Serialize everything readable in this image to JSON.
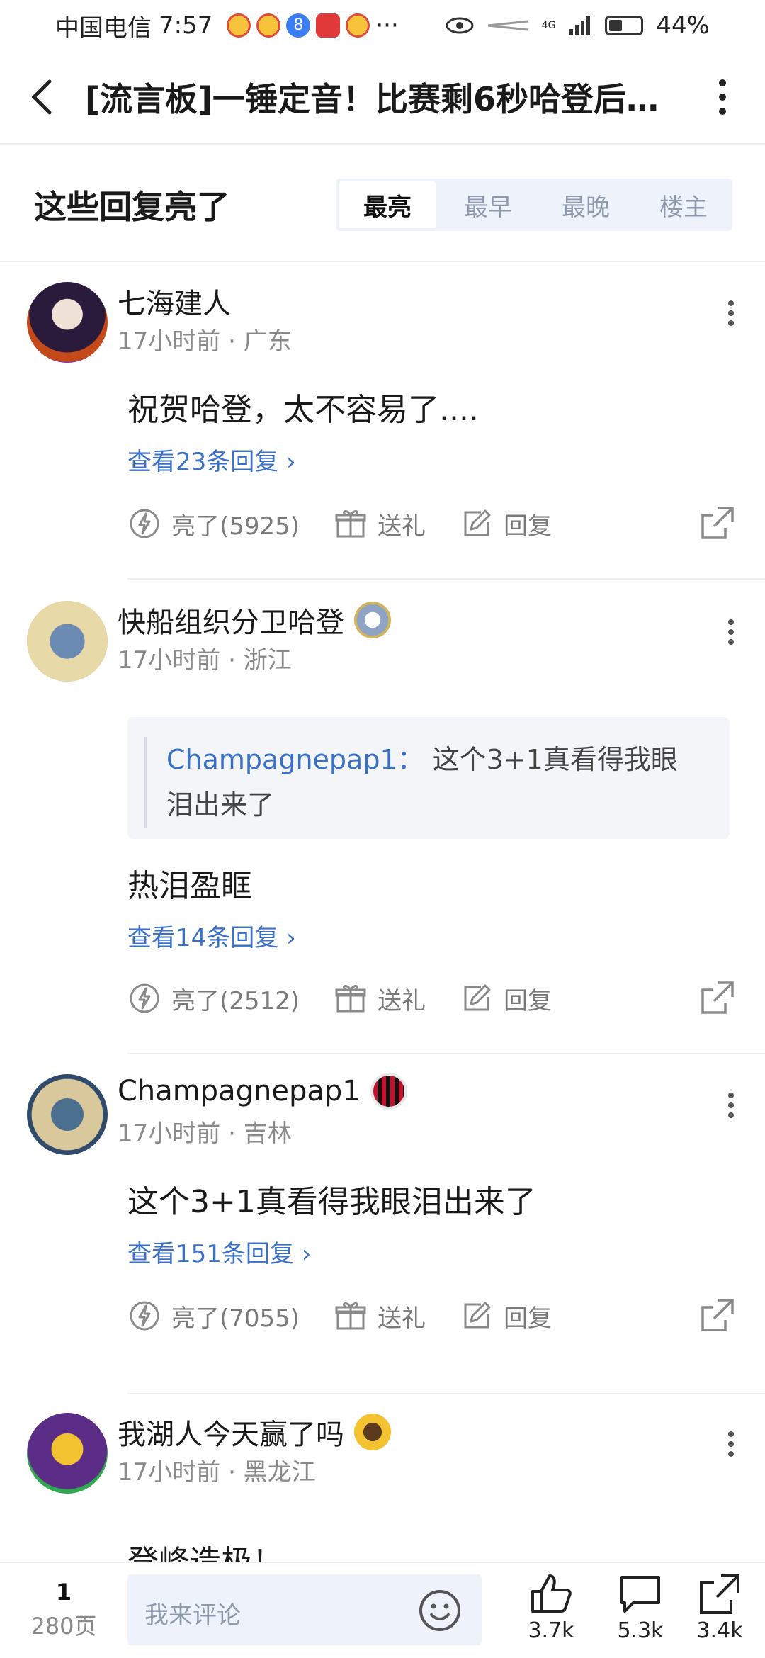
{
  "status_bar": {
    "carrier": "中国电信",
    "time": "7:57",
    "notif_dots": "···",
    "signal_label": "4G",
    "battery": "44%",
    "battery_level": 0.44
  },
  "header": {
    "title": "[流言板]一锤定音！比赛剩6秒哈登后…"
  },
  "section": {
    "title": "这些回复亮了",
    "tabs": [
      "最亮",
      "最早",
      "最晚",
      "楼主"
    ],
    "active_tab": "最亮"
  },
  "comments": [
    {
      "username": "七海建人",
      "time": "17小时前",
      "location": "广东",
      "text": "祝贺哈登，太不容易了....",
      "replies": "查看23条回复",
      "light": "亮了(5925)",
      "gift": "送礼",
      "reply": "回复",
      "avatar_colors": [
        "#2a1b3d",
        "#c44a1a",
        "#7a2fbf"
      ]
    },
    {
      "username": "快船组织分卫哈登",
      "time": "17小时前",
      "location": "浙江",
      "quote_user": "Champagnepap1：",
      "quote_text": "这个3+1真看得我眼泪出来了",
      "text": "热泪盈眶",
      "replies": "查看14条回复",
      "light": "亮了(2512)",
      "gift": "送礼",
      "reply": "回复",
      "avatar_colors": [
        "#e8d9a8",
        "#6c8bb3",
        "#d2b55b"
      ]
    },
    {
      "username": "Champagnepap1",
      "time": "17小时前",
      "location": "吉林",
      "text": "这个3+1真看得我眼泪出来了",
      "replies": "查看151条回复",
      "light": "亮了(7055)",
      "gift": "送礼",
      "reply": "回复",
      "avatar_colors": [
        "#2f4a6b",
        "#d9c89b",
        "#4b6f8f"
      ]
    },
    {
      "username": "我湖人今天赢了吗",
      "time": "17小时前",
      "location": "黑龙江",
      "text": "登峰造极！",
      "avatar_colors": [
        "#5b2d86",
        "#f2c230",
        "#2fa84f"
      ]
    }
  ],
  "bottom_bar": {
    "page_current": "1",
    "page_total": "280页",
    "comment_placeholder": "我来评论",
    "likes": "3.7k",
    "comments": "5.3k",
    "shares": "3.4k"
  },
  "colors": {
    "link_blue": "#3a71c6",
    "tab_bg": "#eef2fb",
    "meta_gray": "#8a8a8a"
  }
}
